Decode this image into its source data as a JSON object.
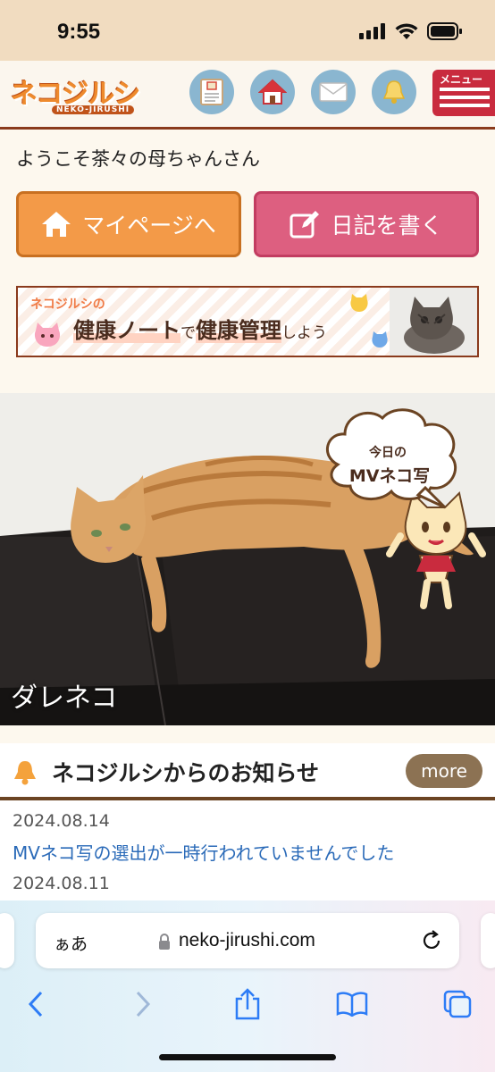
{
  "status_bar": {
    "time": "9:55"
  },
  "header": {
    "logo_text": "ネコジルシ",
    "logo_sub": "NEKO-JIRUSHI",
    "icons": [
      "notebook-icon",
      "home-icon",
      "mail-icon",
      "bell-icon"
    ],
    "menu_label": "メニュー"
  },
  "welcome": "ようこそ茶々の母ちゃんさん",
  "buttons": {
    "mypage": "マイページへ",
    "diary": "日記を書く"
  },
  "banner": {
    "sub": "ネコジルシの",
    "main_1": "健康ノート",
    "main_2": "で",
    "main_3": "健康管理",
    "main_4": "しよう"
  },
  "photo": {
    "bubble_line1": "今日の",
    "bubble_line2": "MVネコ写",
    "cat_name": "ダレネコ"
  },
  "news": {
    "title": "ネコジルシからのお知らせ",
    "more": "more",
    "items": [
      {
        "date": "2024.08.14",
        "text": "MVネコ写の選出が一時行われていませんでした"
      },
      {
        "date": "2024.08.11",
        "text": ""
      }
    ]
  },
  "safari": {
    "aa": "ぁあ",
    "url": "neko-jirushi.com"
  },
  "colors": {
    "header_border": "#8a3a1c",
    "mypage_button": "#f39a48",
    "diary_button": "#dd5f80",
    "menu_button": "#c92b3e",
    "link": "#2a6ab8",
    "more_button": "#8c7253"
  }
}
